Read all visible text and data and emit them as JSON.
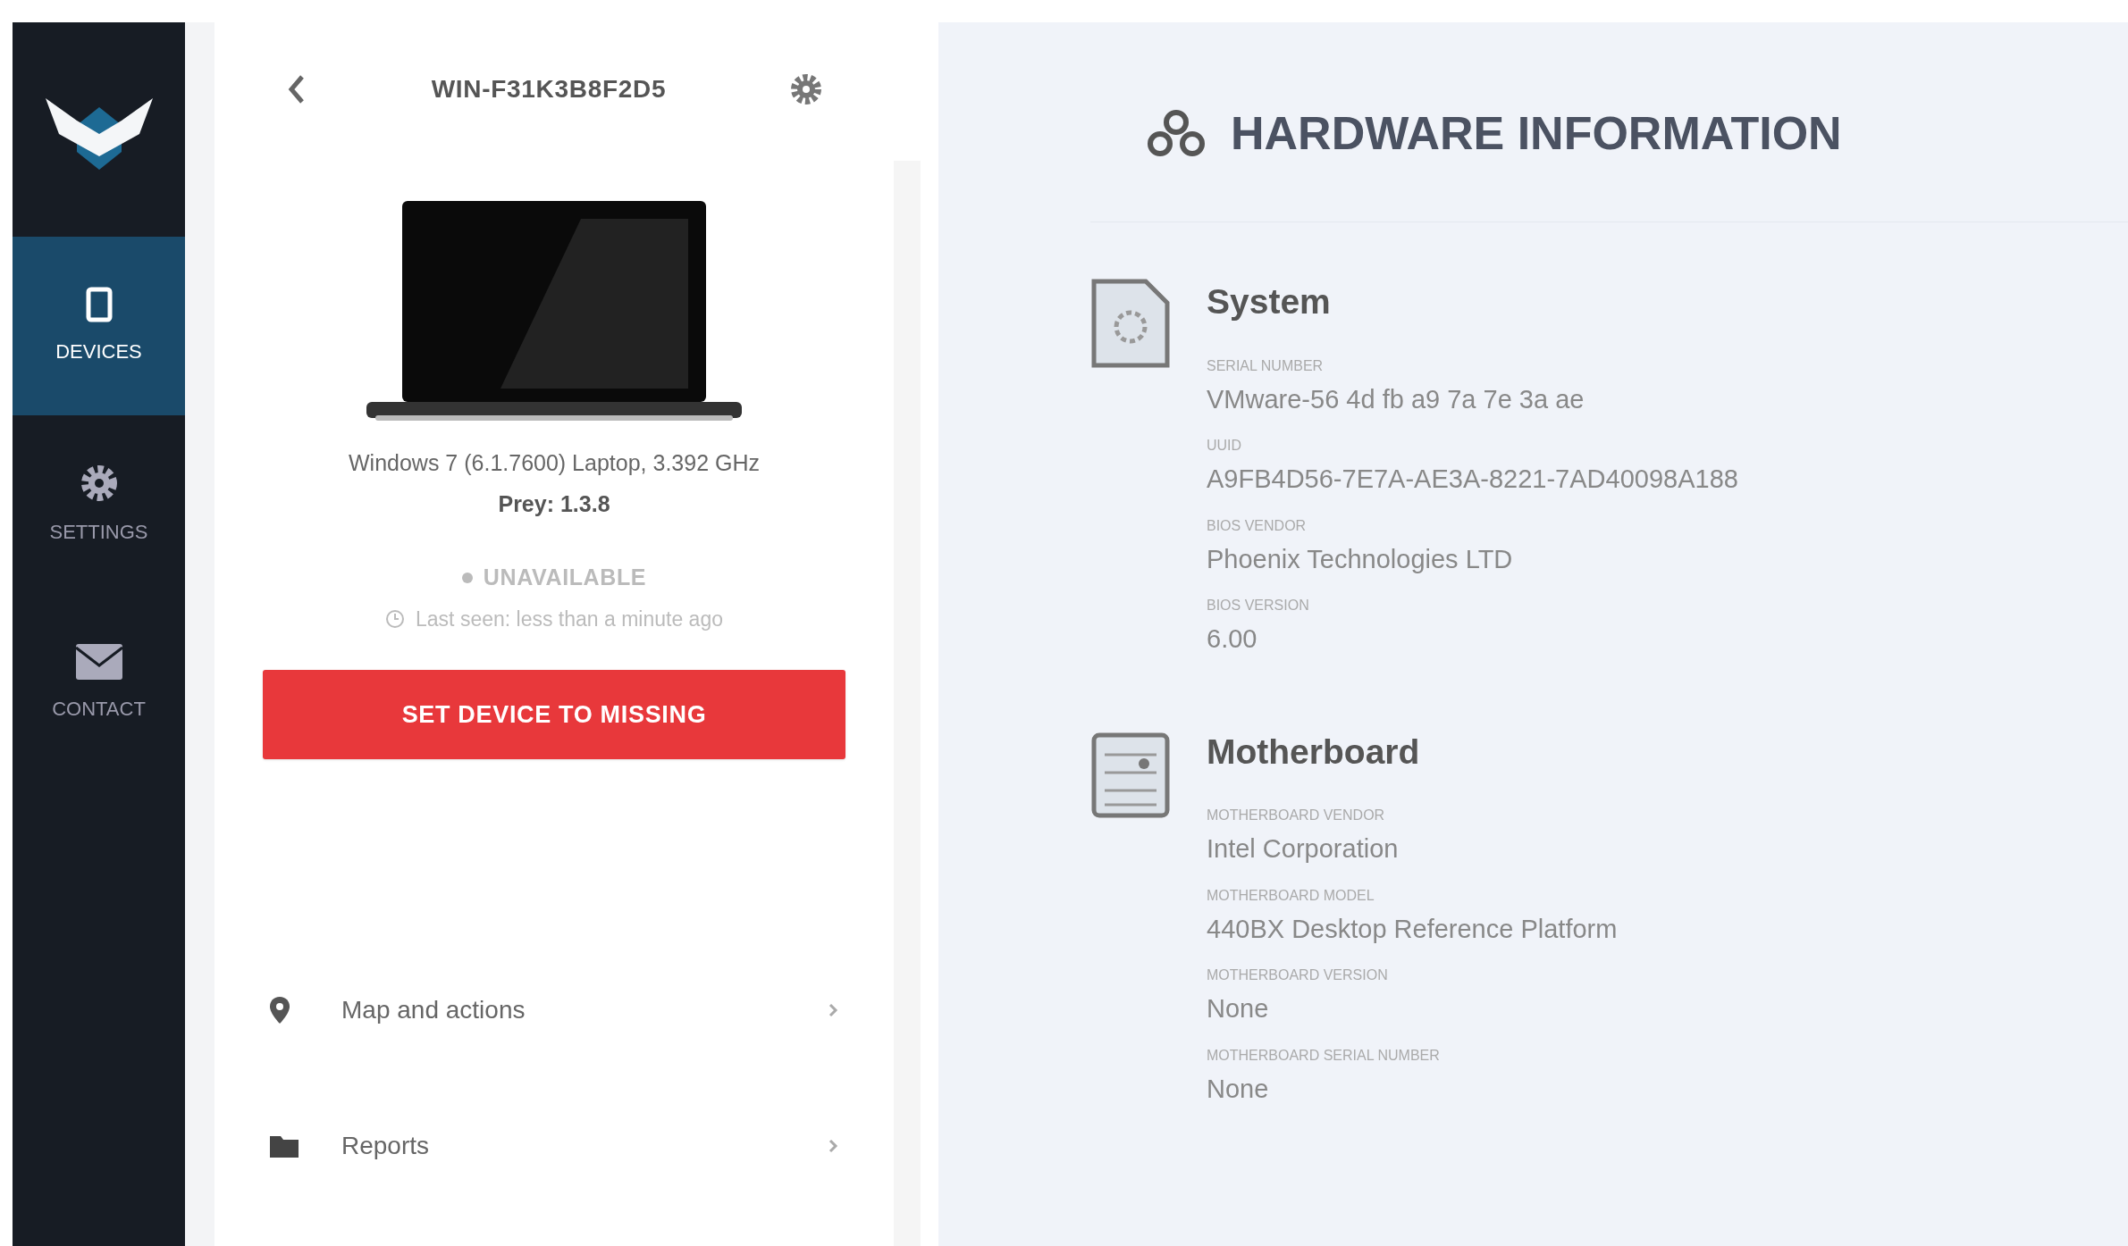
{
  "sidebar": {
    "items": [
      {
        "label": "DEVICES",
        "selected": true
      },
      {
        "label": "SETTINGS",
        "selected": false
      },
      {
        "label": "CONTACT",
        "selected": false
      }
    ]
  },
  "device_panel": {
    "title": "WIN-F31K3B8F2D5",
    "specs": "Windows 7 (6.1.7600) Laptop, 3.392 GHz",
    "agent": "Prey: 1.3.8",
    "status": "UNAVAILABLE",
    "last_seen": "Last seen: less than a minute ago",
    "action_button": "SET DEVICE TO MISSING",
    "links": [
      {
        "label": "Map and actions"
      },
      {
        "label": "Reports"
      }
    ]
  },
  "hardware": {
    "title": "HARDWARE INFORMATION",
    "sections": [
      {
        "title": "System",
        "fields": [
          {
            "label": "SERIAL NUMBER",
            "value": "VMware-56 4d fb a9 7a 7e 3a ae"
          },
          {
            "label": "UUID",
            "value": "A9FB4D56-7E7A-AE3A-8221-7AD40098A188"
          },
          {
            "label": "BIOS VENDOR",
            "value": "Phoenix Technologies LTD"
          },
          {
            "label": "BIOS VERSION",
            "value": "6.00"
          }
        ]
      },
      {
        "title": "Motherboard",
        "fields": [
          {
            "label": "MOTHERBOARD VENDOR",
            "value": "Intel Corporation"
          },
          {
            "label": "MOTHERBOARD MODEL",
            "value": "440BX Desktop Reference Platform"
          },
          {
            "label": "MOTHERBOARD VERSION",
            "value": "None"
          },
          {
            "label": "MOTHERBOARD SERIAL NUMBER",
            "value": "None"
          }
        ]
      }
    ]
  }
}
